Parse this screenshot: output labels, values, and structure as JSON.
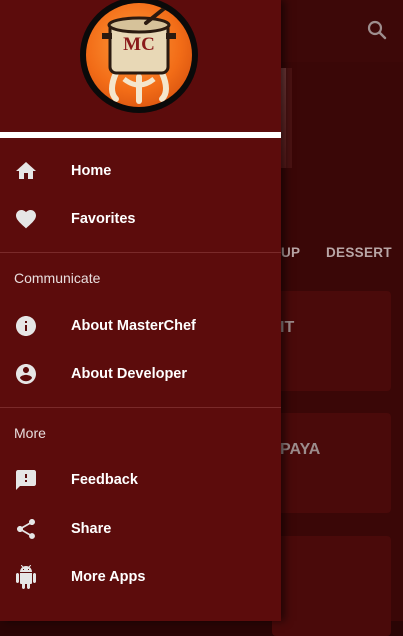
{
  "background": {
    "tabs": [
      "UP",
      "DESSERT"
    ],
    "cards": [
      "IT",
      "PAYA",
      ""
    ]
  },
  "drawer": {
    "logo_text": "MC",
    "primary_items": [
      {
        "label": "Home",
        "icon": "home-icon"
      },
      {
        "label": "Favorites",
        "icon": "heart-icon"
      }
    ],
    "section_communicate": {
      "title": "Communicate",
      "items": [
        {
          "label": "About MasterChef",
          "icon": "info-icon"
        },
        {
          "label": "About Developer",
          "icon": "account-circle-icon"
        }
      ]
    },
    "section_more": {
      "title": "More",
      "items": [
        {
          "label": "Feedback",
          "icon": "feedback-icon"
        },
        {
          "label": "Share",
          "icon": "share-icon"
        },
        {
          "label": "More Apps",
          "icon": "android-icon"
        }
      ]
    }
  },
  "colors": {
    "drawer_bg": "#5c0c0c",
    "icon": "#e6e6e6",
    "logo_orange": "#f26c17"
  }
}
